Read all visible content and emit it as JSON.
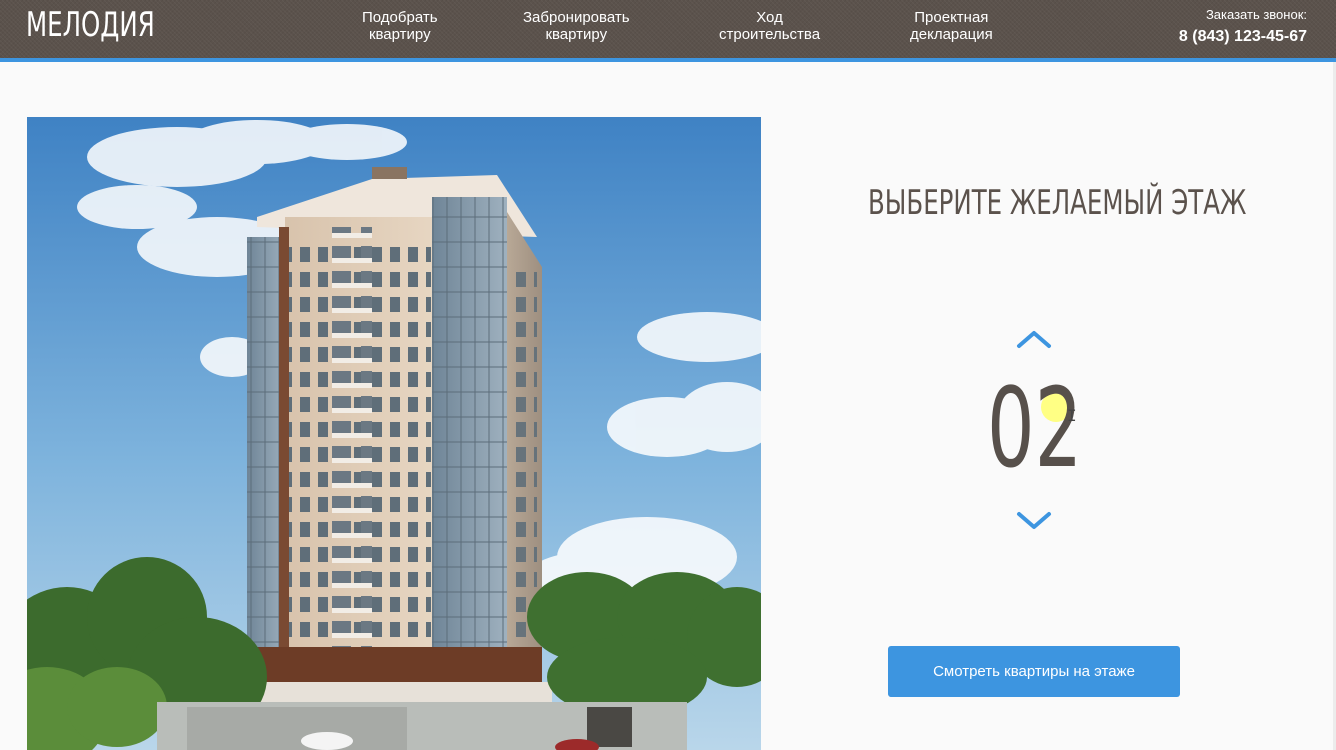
{
  "header": {
    "logo": "МЕЛОДИЯ",
    "nav": [
      {
        "line1": "Подобрать",
        "line2": "квартиру"
      },
      {
        "line1": "Забронировать",
        "line2": "квартиру"
      },
      {
        "line1": "Ход",
        "line2": "строительства"
      },
      {
        "line1": "Проектная",
        "line2": "декларация"
      }
    ],
    "callback_label": "Заказать звонок:",
    "phone": "8 (843) 123-45-67"
  },
  "floor_selector": {
    "title": "ВЫБЕРИТЕ ЖЕЛАЕМЫЙ ЭТАЖ",
    "floor": "02",
    "up_icon": "chevron-up-icon",
    "down_icon": "chevron-down-icon",
    "button_label": "Смотреть квартиры на этаже"
  },
  "colors": {
    "header_bg": "#5b524c",
    "accent": "#3d95e0",
    "text_dark": "#57504b",
    "page_bg": "#fafafa"
  }
}
